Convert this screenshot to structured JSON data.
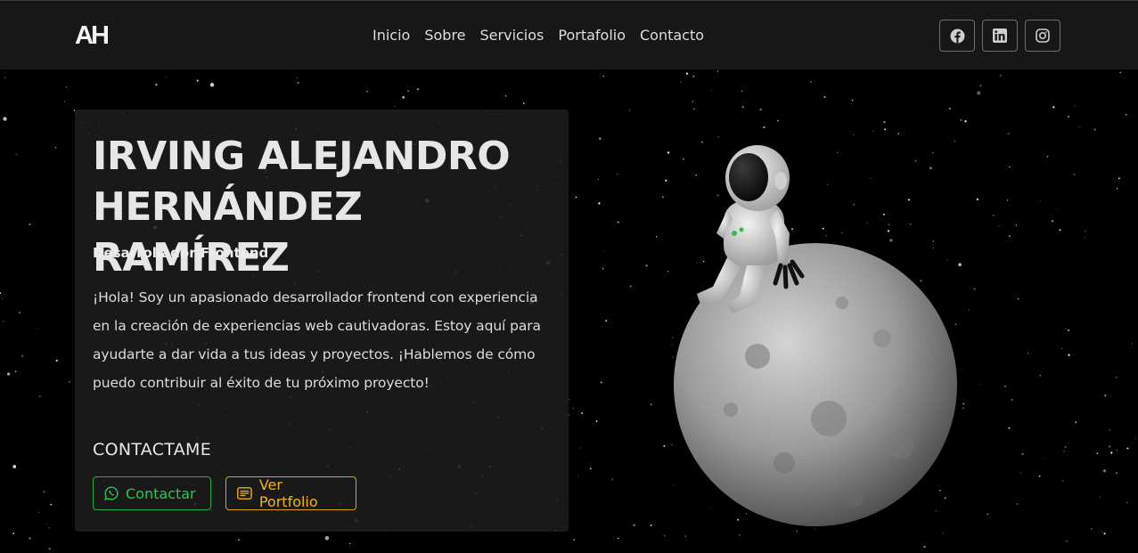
{
  "logo": {
    "text": "AH"
  },
  "nav": {
    "links": [
      "Inicio",
      "Sobre",
      "Servicios",
      "Portafolio",
      "Contacto"
    ]
  },
  "social": [
    {
      "icon": "facebook-icon"
    },
    {
      "icon": "linkedin-icon"
    },
    {
      "icon": "instagram-icon"
    }
  ],
  "hero": {
    "name_line1": "IRVING ALEJANDRO",
    "name_line2": "HERNÁNDEZ RAMÍREZ",
    "role": "Desarrollador Frontend",
    "bio": "¡Hola! Soy un apasionado desarrollador frontend con experiencia en la creación de experiencias web cautivadoras. Estoy aquí para ayudarte a dar vida a tus ideas y proyectos. ¡Hablemos de cómo puedo contribuir al éxito de tu próximo proyecto!",
    "contact_title": "CONTACTAME",
    "contact_button": "Contactar",
    "portfolio_button": "Ver Portfolio"
  },
  "colors": {
    "contact_green": "#28c458",
    "portfolio_yellow": "#efb510",
    "navbar_bg": "#181818"
  }
}
